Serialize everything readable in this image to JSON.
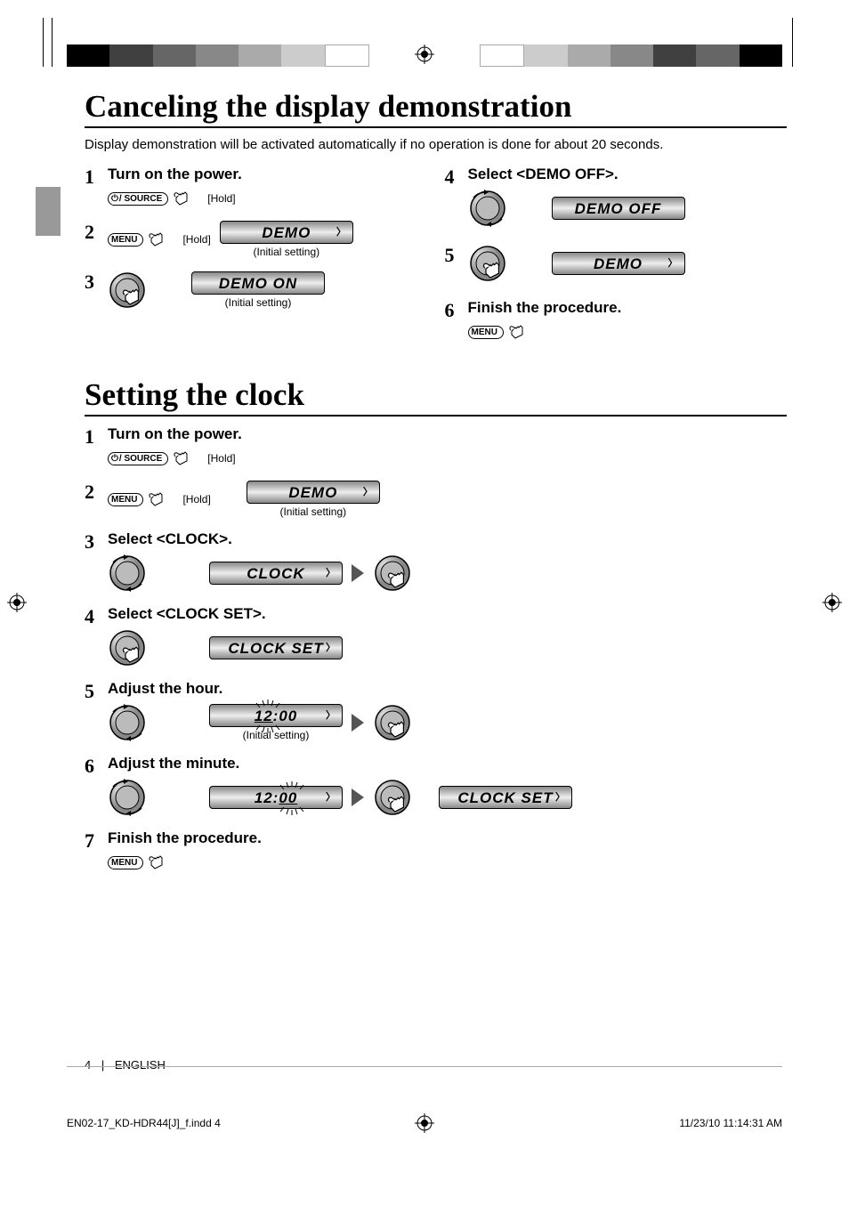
{
  "section1": {
    "heading": "Canceling the display demonstration",
    "intro": "Display demonstration will be activated automatically if no operation is done for about 20 seconds.",
    "steps_left": [
      {
        "n": "1",
        "title": "Turn on the power.",
        "btn": "/ SOURCE",
        "hold": "[Hold]"
      },
      {
        "n": "2",
        "btn": "MENU",
        "hold": "[Hold]",
        "lcd": "DEMO",
        "arrow": true,
        "caption": "(Initial setting)"
      },
      {
        "n": "3",
        "lcd": "DEMO ON",
        "caption": "(Initial setting)"
      }
    ],
    "steps_right": [
      {
        "n": "4",
        "title": "Select <DEMO OFF>.",
        "lcd": "DEMO OFF"
      },
      {
        "n": "5",
        "lcd": "DEMO",
        "arrow": true
      },
      {
        "n": "6",
        "title": "Finish the procedure.",
        "btn": "MENU"
      }
    ]
  },
  "section2": {
    "heading": "Setting the clock",
    "steps": [
      {
        "n": "1",
        "title": "Turn on the power.",
        "btn": "/ SOURCE",
        "hold": "[Hold]"
      },
      {
        "n": "2",
        "btn": "MENU",
        "hold": "[Hold]",
        "lcd": "DEMO",
        "arrow": true,
        "caption": "(Initial setting)"
      },
      {
        "n": "3",
        "title": "Select <CLOCK>.",
        "lcd": "CLOCK",
        "arrow": true,
        "then_press": true
      },
      {
        "n": "4",
        "title": "Select <CLOCK SET>.",
        "lcd": "CLOCK SET",
        "arrow": true
      },
      {
        "n": "5",
        "title": "Adjust the hour.",
        "lcd": "12:00",
        "arrow": true,
        "caption": "(Initial setting)",
        "then_press": true,
        "blink": "hour"
      },
      {
        "n": "6",
        "title": "Adjust the minute.",
        "lcd": "12:00",
        "arrow": true,
        "then_press": true,
        "blink": "min",
        "lcd2": "CLOCK SET",
        "arrow2": true
      },
      {
        "n": "7",
        "title": "Finish the procedure.",
        "btn": "MENU"
      }
    ]
  },
  "footer": {
    "page": "4",
    "divider": "|",
    "lang": "ENGLISH"
  },
  "imprint": {
    "file": "EN02-17_KD-HDR44[J]_f.indd   4",
    "date": "11/23/10   11:14:31 AM"
  },
  "colors_left": [
    "#000",
    "#404040",
    "#666",
    "#888",
    "#aaa",
    "#ccc",
    "#fff"
  ],
  "colors_right": [
    "#fff",
    "#ccc",
    "#aaa",
    "#888",
    "#666",
    "#404040",
    "#000"
  ]
}
